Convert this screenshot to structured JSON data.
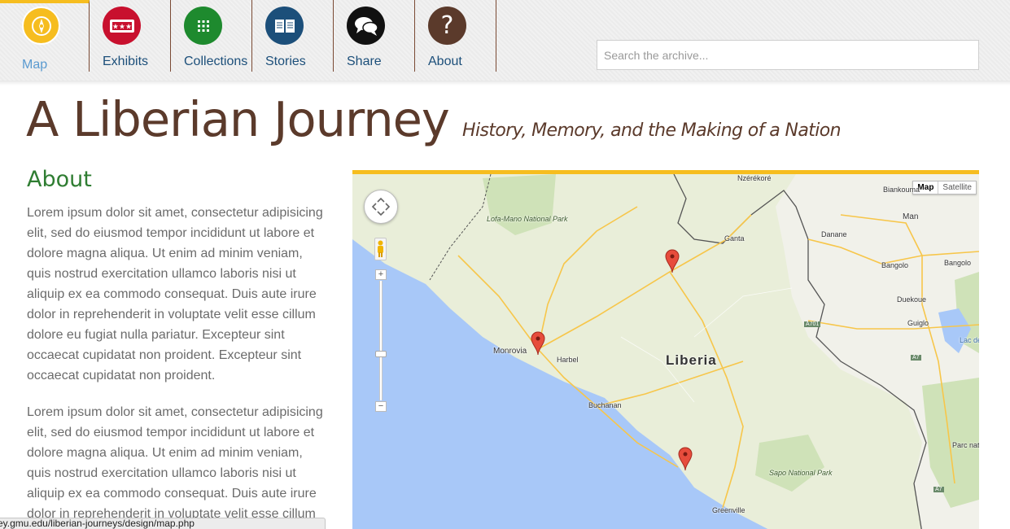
{
  "nav": {
    "items": [
      {
        "label": "Map",
        "icon": "compass-icon",
        "color": "#f6bd1f",
        "active": true
      },
      {
        "label": "Exhibits",
        "icon": "ticket-icon",
        "color": "#c8102e"
      },
      {
        "label": "Collections",
        "icon": "grid-icon",
        "color": "#1e8a2e"
      },
      {
        "label": "Stories",
        "icon": "book-icon",
        "color": "#1c4f7a"
      },
      {
        "label": "Share",
        "icon": "speech-bubbles-icon",
        "color": "#111111"
      },
      {
        "label": "About",
        "icon": "question-mark-icon",
        "color": "#5b3a2b"
      }
    ]
  },
  "search": {
    "placeholder": "Search the archive..."
  },
  "header": {
    "title": "A Liberian Journey",
    "subtitle": "History, Memory, and the Making of a Nation"
  },
  "about": {
    "heading": "About",
    "paragraphs": [
      "Lorem ipsum dolor sit amet, consectetur adipisicing elit, sed do eiusmod tempor incididunt ut labore et dolore magna aliqua. Ut enim ad minim veniam, quis nostrud exercitation ullamco laboris nisi ut aliquip ex ea commodo consequat. Duis aute irure dolor in reprehenderit in voluptate velit esse cillum dolore eu fugiat nulla pariatur. Excepteur sint occaecat cupidatat non proident. Excepteur sint occaecat cupidatat non proident.",
      "Lorem ipsum dolor sit amet, consectetur adipisicing elit, sed do eiusmod tempor incididunt ut labore et dolore magna aliqua. Ut enim ad minim veniam, quis nostrud exercitation ullamco laboris nisi ut aliquip ex ea commodo consequat. Duis aute irure dolor in reprehenderit in voluptate velit esse cillum"
    ]
  },
  "map": {
    "map_type": {
      "map": "Map",
      "satellite": "Satellite"
    },
    "zoom": {
      "plus": "+",
      "minus": "−"
    },
    "places": {
      "nzerekore": "Nzérékoré",
      "biankouma": "Biankouma",
      "man": "Man",
      "lofa_mano": "Lofa-Mano National Park",
      "ganta": "Ganta",
      "danane": "Danane",
      "bangolo_1": "Bangolo",
      "bangolo_2": "Bangolo",
      "duekoue": "Duekoue",
      "a701": "A701",
      "guiglo": "Guiglo",
      "lac_de": "Lac de",
      "a7_1": "A7",
      "a7_2": "A7",
      "monrovia": "Monrovia",
      "harbel": "Harbel",
      "liberia": "Liberia",
      "buchanan": "Buchanan",
      "parc_nat": "Parc nat",
      "sapo": "Sapo National Park",
      "greenville": "Greenville"
    },
    "colors": {
      "land": "#e9eed9",
      "water": "#a8c8f8",
      "road": "#f7c64a",
      "border": "#555555"
    }
  },
  "status_url": "ey.gmu.edu/liberian-journeys/design/map.php"
}
